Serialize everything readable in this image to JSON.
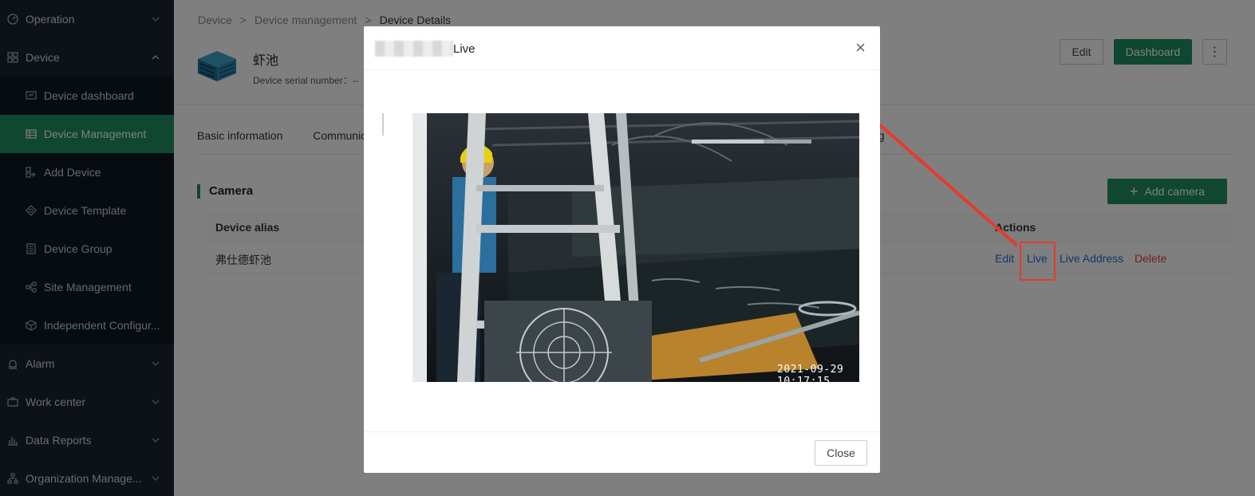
{
  "sidebar": {
    "operation": "Operation",
    "device": "Device",
    "items": [
      {
        "label": "Device dashboard",
        "icon": "dashboard-icon"
      },
      {
        "label": "Device Management",
        "icon": "table-icon"
      },
      {
        "label": "Add Device",
        "icon": "add-device-icon"
      },
      {
        "label": "Device Template",
        "icon": "template-icon"
      },
      {
        "label": "Device Group",
        "icon": "group-icon"
      },
      {
        "label": "Site Management",
        "icon": "site-icon"
      },
      {
        "label": "Independent Configur...",
        "icon": "cube-icon"
      }
    ],
    "alarm": "Alarm",
    "work_center": "Work center",
    "data_reports": "Data Reports",
    "org": "Organization Manage..."
  },
  "breadcrumb": {
    "b1": "Device",
    "sep": ">",
    "b2": "Device management",
    "b3": "Device Details"
  },
  "device": {
    "name": "虾池",
    "serial_label": "Device serial number：",
    "serial_value": "--"
  },
  "header_buttons": {
    "edit": "Edit",
    "dashboard": "Dashboard",
    "more": "⋮"
  },
  "tabs": {
    "basic": "Basic information",
    "comm": "Communica",
    "log": "og"
  },
  "camera": {
    "title": "Camera",
    "add": "Add camera",
    "col_alias": "Device alias",
    "col_actions": "Actions",
    "row_alias": "弗仕德虾池",
    "act_edit": "Edit",
    "act_live": "Live",
    "act_address": "Live Address",
    "act_delete": "Delete"
  },
  "modal": {
    "title_suffix": "Live",
    "timestamp": "2021-09-29 10:17:15",
    "close": "Close",
    "close_x": "×"
  },
  "colors": {
    "brand": "#1f8f63",
    "sidebar": "#1a2433",
    "link": "#1f6fd6",
    "danger": "#e04040",
    "annotation": "#e53b2c"
  }
}
